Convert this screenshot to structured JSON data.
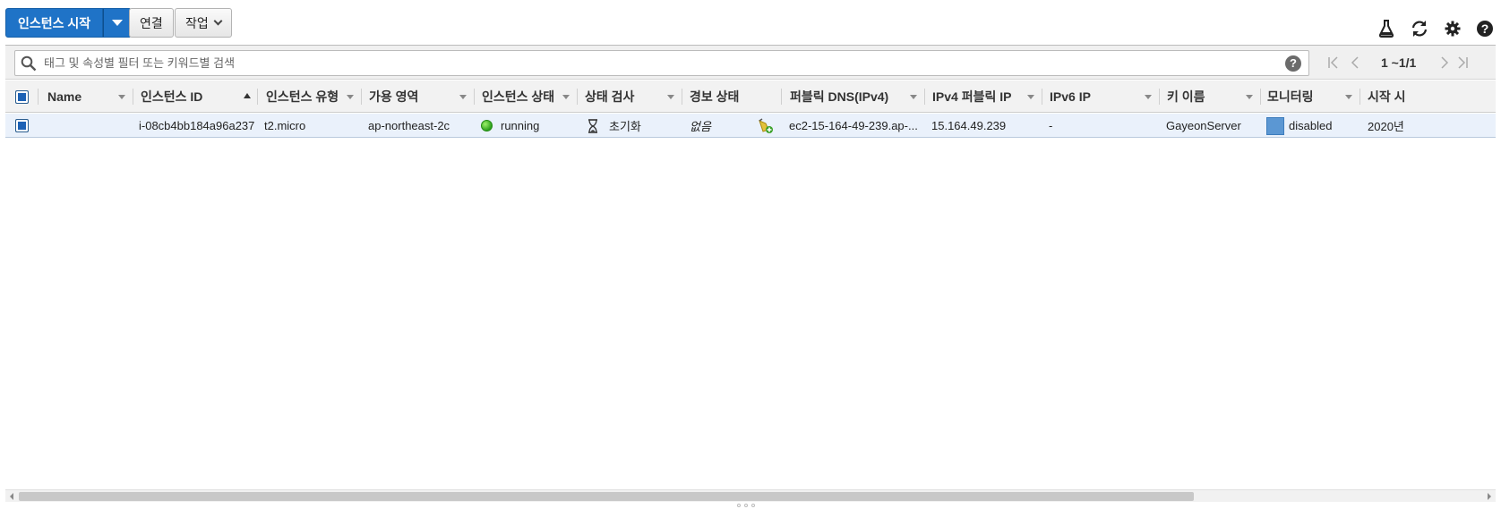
{
  "toolbar": {
    "launch_label": "인스턴스 시작",
    "connect_label": "연결",
    "actions_label": "작업"
  },
  "top_icons": [
    "flask-icon",
    "refresh-icon",
    "gear-icon",
    "help-icon"
  ],
  "search": {
    "placeholder": "태그 및 속성별 필터 또는 키워드별 검색",
    "help": "?"
  },
  "pagination": {
    "text": "1 ~1/1"
  },
  "table": {
    "columns": {
      "name": "Name",
      "instance_id": "인스턴스 ID",
      "instance_type": "인스턴스 유형",
      "az": "가용 영역",
      "state": "인스턴스 상태",
      "status_check": "상태 검사",
      "alarm_status": "경보 상태",
      "public_dns": "퍼블릭 DNS(IPv4)",
      "ipv4": "IPv4 퍼블릭 IP",
      "ipv6": "IPv6 IP",
      "key_name": "키 이름",
      "monitoring": "모니터링",
      "launch_time": "시작 시"
    },
    "rows": [
      {
        "name": "",
        "instance_id": "i-08cb4bb184a96a237",
        "instance_type": "t2.micro",
        "az": "ap-northeast-2c",
        "state": "running",
        "status_check": "초기화",
        "alarm_status": "없음",
        "public_dns": "ec2-15-164-49-239.ap-...",
        "ipv4": "15.164.49.239",
        "ipv6": "-",
        "key_name": "GayeonServer",
        "monitoring": "disabled",
        "launch_time": "2020년"
      }
    ]
  },
  "colors": {
    "primary_button": "#1f73c7",
    "running_dot": "#2da01c",
    "selected_row": "#eaf1fb",
    "monitoring_square": "#5b97d3"
  }
}
